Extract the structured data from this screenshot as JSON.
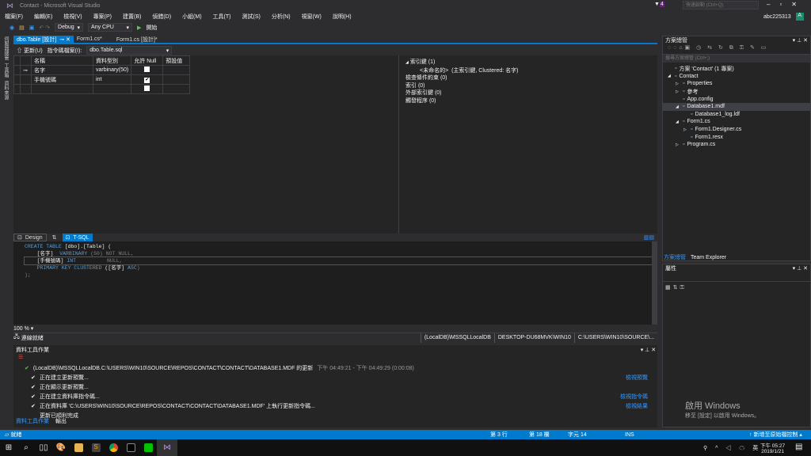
{
  "window": {
    "title": "Contact - Microsoft Visual Studio",
    "notif_count": "4",
    "quick_launch_placeholder": "快速啟動 (Ctrl+Q)",
    "user": "abc225313",
    "avatar_letter": "A"
  },
  "menu": [
    "檔案(F)",
    "編輯(E)",
    "檢視(V)",
    "專案(P)",
    "建置(B)",
    "偵錯(D)",
    "小組(M)",
    "工具(T)",
    "測試(S)",
    "分析(N)",
    "視窗(W)",
    "說明(H)"
  ],
  "toolbar": {
    "config": "Debug",
    "platform": "Any CPU",
    "start": "開始"
  },
  "left_strip": [
    "伺服器總管",
    "工具箱",
    "資料來源"
  ],
  "doc_tabs": [
    {
      "label": "dbo.Table [設計]",
      "active": true
    },
    {
      "label": "Form1.cs*"
    },
    {
      "label": "Form1.cs [設計]*"
    }
  ],
  "designer": {
    "update": "更新(U)",
    "script_label": "指令碼檔案(I):",
    "script_file": "dbo.Table.sql",
    "columns": [
      "名稱",
      "資料型別",
      "允許 Null",
      "預設值"
    ],
    "rows": [
      {
        "name": "名字",
        "type": "varbinary(50)",
        "nullable": false,
        "key": true
      },
      {
        "name": "手機號碼",
        "type": "int",
        "nullable": true
      },
      {
        "name": "",
        "type": "",
        "nullable": false
      }
    ]
  },
  "keys": {
    "primary": "索引鍵 (1)",
    "primary_item": "<未命名的>",
    "primary_desc": "(主索引鍵, Clustered: 名字)",
    "check": "檢查條件約束 (0)",
    "index": "索引 (0)",
    "fk": "外部索引鍵 (0)",
    "trigger": "觸發程序 (0)"
  },
  "sql_tabs": {
    "design": "Design",
    "swap": "⇅",
    "tsql": "T-SQL"
  },
  "sql_lines": [
    [
      {
        "t": "CREATE TABLE ",
        "c": "kw"
      },
      {
        "t": "[dbo].[Table] (",
        "c": ""
      }
    ],
    [
      {
        "t": "    [名字]  ",
        "c": ""
      },
      {
        "t": "VARBINARY ",
        "c": "kw"
      },
      {
        "t": "(50) NOT NULL,",
        "c": "gr"
      }
    ],
    [
      {
        "t": "    [手機號碼] ",
        "c": ""
      },
      {
        "t": "INT",
        "c": "kw"
      },
      {
        "t": "          NULL,",
        "c": "gr"
      }
    ],
    [
      {
        "t": "    PRIMARY KEY CLUSTERED ",
        "c": "kw"
      },
      {
        "t": "([名字] ",
        "c": ""
      },
      {
        "t": "ASC",
        "c": "kw"
      },
      {
        "t": ")",
        "c": "gr"
      }
    ],
    [
      {
        "t": ");",
        "c": "gr"
      }
    ]
  ],
  "zoom": "100 %",
  "connection": {
    "status": "連線就緒",
    "server": "(LocalDB)\\MSSQLLocalDB",
    "machine": "DESKTOP-DU68MVK\\WIN10",
    "path": "C:\\USERS\\WIN10\\SOURCE\\..."
  },
  "data_tools": {
    "title": "資料工具作業",
    "header": "(LocalDB)\\MSSQLLocalDB.C:\\USERS\\WIN10\\SOURCE\\REPOS\\CONTACT\\CONTACT\\DATABASE1.MDF 的更新",
    "time": "下午 04:49:21 - 下午 04:49:29 (0:00:08)",
    "tasks": [
      {
        "text": "正在建立更新預覽...",
        "link": "檢視預覽",
        "done": true
      },
      {
        "text": "正在顯示更新預覽...",
        "link": "",
        "done": true
      },
      {
        "text": "正在建立資料庫指令碼...",
        "link": "檢視指令碼",
        "done": true
      },
      {
        "text": "正在資料庫 'C:\\USERS\\WIN10\\SOURCE\\REPOS\\CONTACT\\CONTACT\\DATABASE1.MDF' 上執行更新指令碼...",
        "link": "檢視結果",
        "done": true
      },
      {
        "text": "更新已順利完成",
        "link": "",
        "done": false
      }
    ],
    "tabs": [
      "資料工具作業",
      "輸出"
    ]
  },
  "solution_explorer": {
    "title": "方案總管",
    "search_placeholder": "搜尋方案總管 (Ctrl+;)",
    "items": [
      {
        "label": "方案 'Contact' (1 專案)",
        "level": 0,
        "arrow": ""
      },
      {
        "label": "Contact",
        "level": 0,
        "arrow": "◢"
      },
      {
        "label": "Properties",
        "level": 1,
        "arrow": "▷"
      },
      {
        "label": "參考",
        "level": 1,
        "arrow": "▷"
      },
      {
        "label": "App.config",
        "level": 1,
        "arrow": ""
      },
      {
        "label": "Database1.mdf",
        "level": 1,
        "arrow": "◢",
        "selected": true
      },
      {
        "label": "Database1_log.ldf",
        "level": 2,
        "arrow": ""
      },
      {
        "label": "Form1.cs",
        "level": 1,
        "arrow": "◢"
      },
      {
        "label": "Form1.Designer.cs",
        "level": 2,
        "arrow": "▷"
      },
      {
        "label": "Form1.resx",
        "level": 2,
        "arrow": ""
      },
      {
        "label": "Program.cs",
        "level": 1,
        "arrow": "▷"
      }
    ],
    "tabs": [
      "方案總管",
      "Team Explorer"
    ]
  },
  "properties": {
    "title": "屬性"
  },
  "watermark": {
    "title": "啟用 Windows",
    "sub": "移至 [設定] 以啟用 Windows。"
  },
  "status": {
    "ready": "就緒",
    "line": "第 3 行",
    "col": "第 18 欄",
    "ch": "字元 14",
    "ins": "INS",
    "source_control": "新增至原始檔控制"
  },
  "taskbar": {
    "ime": "英",
    "time": "下午 05:27",
    "date": "2019/1/21"
  },
  "colors": {
    "accent": "#007acc",
    "bg": "#2d2d30"
  }
}
